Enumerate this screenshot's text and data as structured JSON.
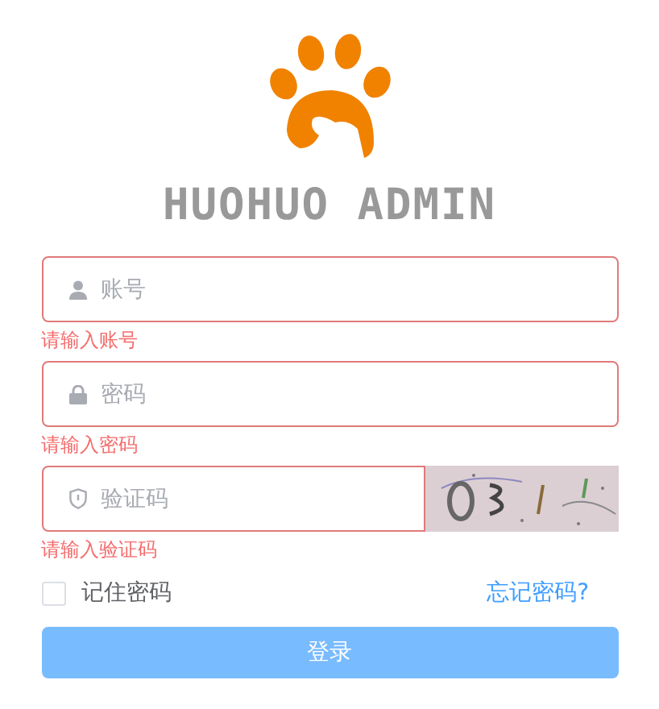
{
  "title": "HUOHUO ADMIN",
  "fields": [
    {
      "kind": "user",
      "placeholder": "账号",
      "error": "请输入账号"
    },
    {
      "kind": "password",
      "placeholder": "密码",
      "error": "请输入密码"
    },
    {
      "kind": "captcha",
      "placeholder": "验证码",
      "error": "请输入验证码"
    }
  ],
  "remember": {
    "label": "记住密码",
    "checked": false
  },
  "forgot_link": "忘记密码?",
  "login_button": "登录"
}
